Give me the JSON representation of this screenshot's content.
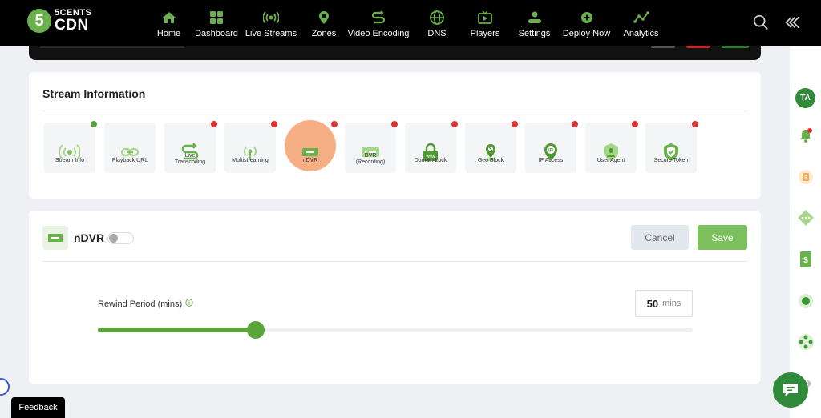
{
  "brand": {
    "logo_number": "5",
    "line1": "5CENTS",
    "line2": "CDN"
  },
  "nav": {
    "items": [
      {
        "label": "Home",
        "icon": "home-icon"
      },
      {
        "label": "Dashboard",
        "icon": "dashboard-icon"
      },
      {
        "label": "Live Streams",
        "icon": "live-streams-icon"
      },
      {
        "label": "Zones",
        "icon": "zones-icon"
      },
      {
        "label": "Video Encoding",
        "icon": "video-encoding-icon"
      },
      {
        "label": "DNS",
        "icon": "dns-icon"
      },
      {
        "label": "Players",
        "icon": "players-icon"
      },
      {
        "label": "Settings",
        "icon": "settings-icon"
      },
      {
        "label": "Deploy Now",
        "icon": "deploy-icon"
      },
      {
        "label": "Analytics",
        "icon": "analytics-icon"
      }
    ]
  },
  "stream_info": {
    "title": "Stream Information",
    "tiles": [
      {
        "label": "Stream Info",
        "status": "green"
      },
      {
        "label": "Playback URL",
        "status": "none"
      },
      {
        "label": "Live Transcoding",
        "status": "red"
      },
      {
        "label": "Multistreaming",
        "status": "red"
      },
      {
        "label": "nDVR",
        "status": "red",
        "active": true
      },
      {
        "label": "DVR (Recording)",
        "status": "red"
      },
      {
        "label": "Domain Lock",
        "status": "red"
      },
      {
        "label": "Geo Block",
        "status": "red"
      },
      {
        "label": "IP Access",
        "status": "red"
      },
      {
        "label": "User Agent",
        "status": "red"
      },
      {
        "label": "Secure Token",
        "status": "red"
      }
    ]
  },
  "ndvr": {
    "title": "nDVR",
    "enabled": false,
    "cancel_label": "Cancel",
    "save_label": "Save",
    "rewind_label": "Rewind Period (mins)",
    "rewind_value": "50",
    "rewind_unit": "mins",
    "slider_fraction": 0.265
  },
  "sidebar": {
    "avatar": "TA"
  },
  "feedback_label": "Feedback",
  "colors": {
    "accent": "#6ab04c",
    "dark_green": "#2f8a3a",
    "red_dot": "#e03131",
    "halo": "#f4a070"
  }
}
